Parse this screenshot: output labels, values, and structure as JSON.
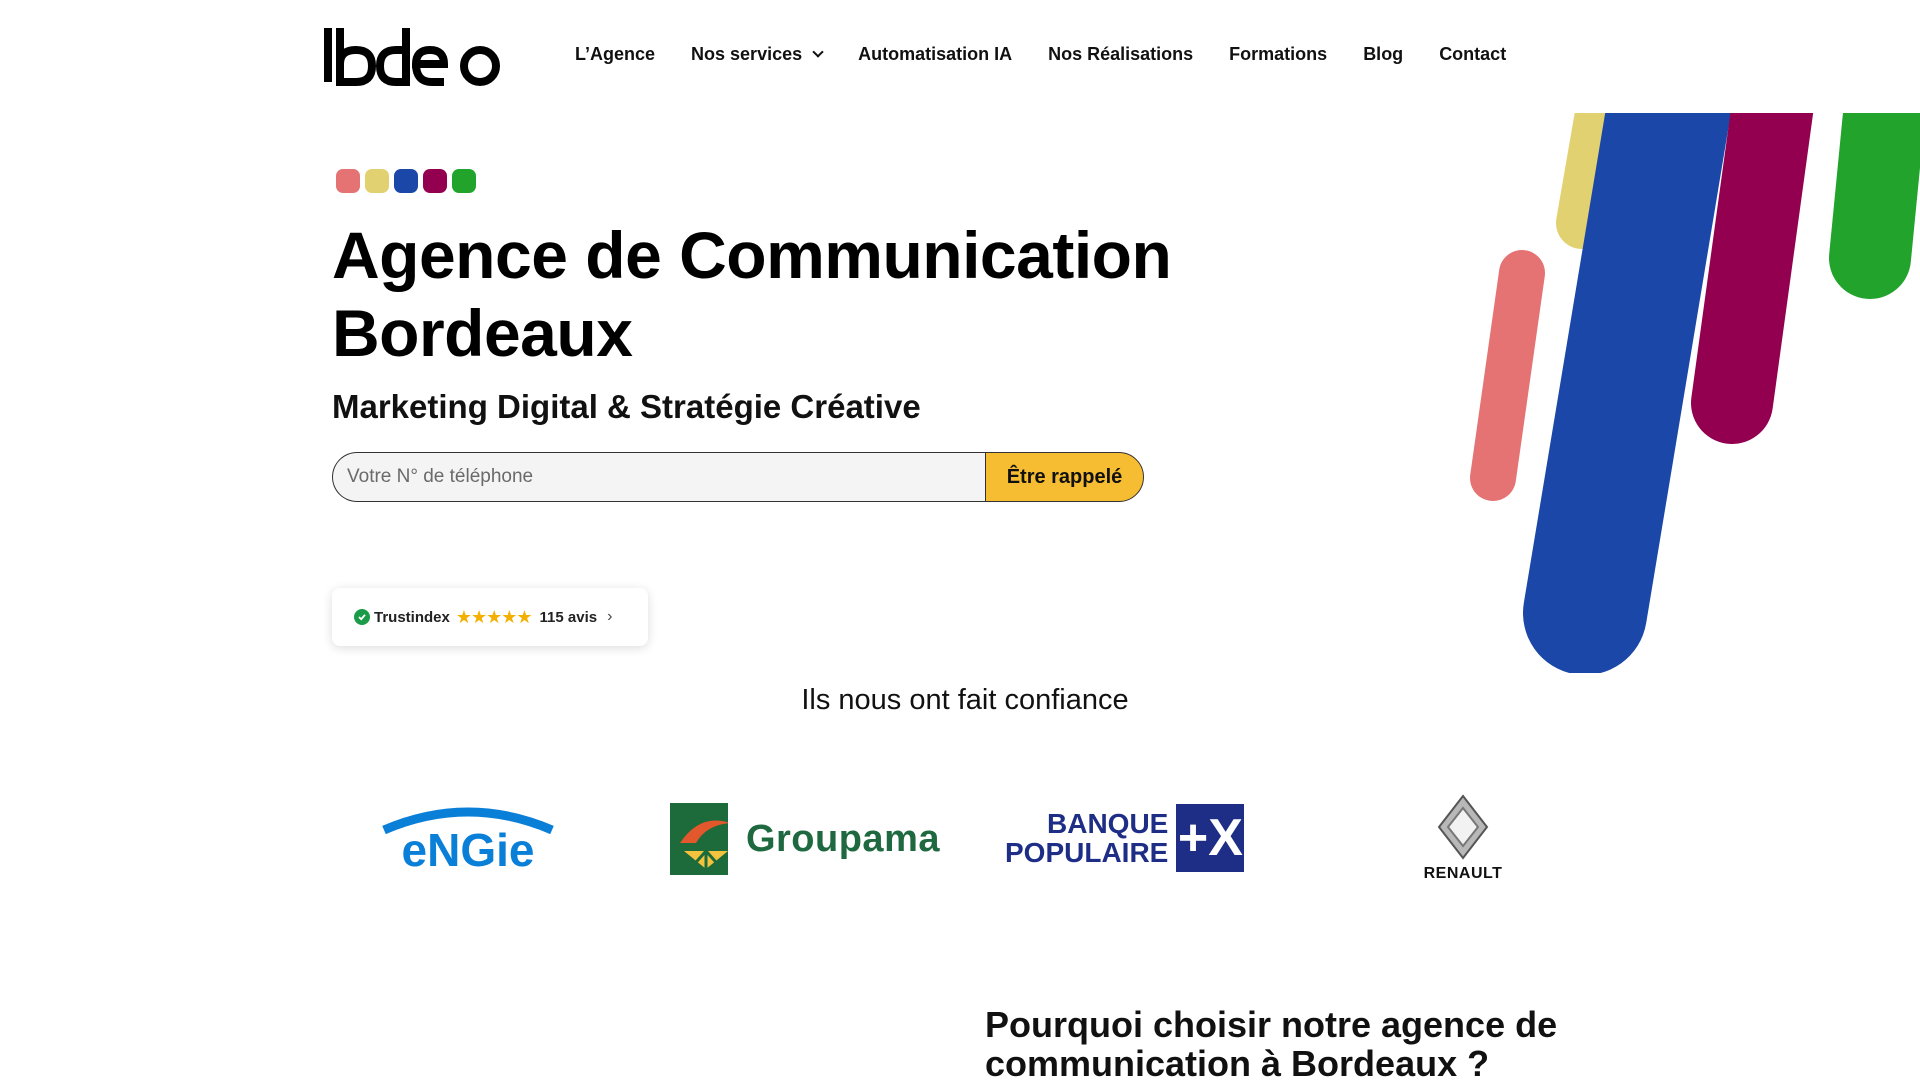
{
  "header": {
    "logo_text": "lbdeo",
    "nav": [
      {
        "label": "L’Agence"
      },
      {
        "label": "Nos services",
        "has_dropdown": true
      },
      {
        "label": "Automatisation IA"
      },
      {
        "label": "Nos Réalisations"
      },
      {
        "label": "Formations"
      },
      {
        "label": "Blog"
      },
      {
        "label": "Contact"
      }
    ]
  },
  "brand_colors": [
    "#e57373",
    "#e2d171",
    "#1a47a8",
    "#93004f",
    "#22a32c"
  ],
  "hero": {
    "title": "Agence de Communication Bordeaux",
    "subtitle": "Marketing Digital & Stratégie Créative",
    "phone_placeholder": "Votre N° de téléphone",
    "callback_button": "Être rappelé"
  },
  "trust_badge": {
    "name": "Trustindex",
    "rating_stars": 4.5,
    "stars": "★★★★★",
    "count": "115 avis",
    "arrow": "›"
  },
  "clients": {
    "heading": "Ils nous ont fait confiance",
    "logos": [
      {
        "name": "engie",
        "text": "eNGie",
        "color": "#0a7fd8"
      },
      {
        "name": "groupama",
        "text": "Groupama",
        "color": "#1f6940"
      },
      {
        "name": "banque-populaire",
        "line1": "BANQUE",
        "line2": "POPULAIRE",
        "mark": "+X",
        "color": "#1e2e86"
      },
      {
        "name": "renault",
        "text": "RENAULT"
      }
    ]
  },
  "why_section": {
    "heading": "Pourquoi choisir notre agence de communication à Bordeaux ?"
  }
}
